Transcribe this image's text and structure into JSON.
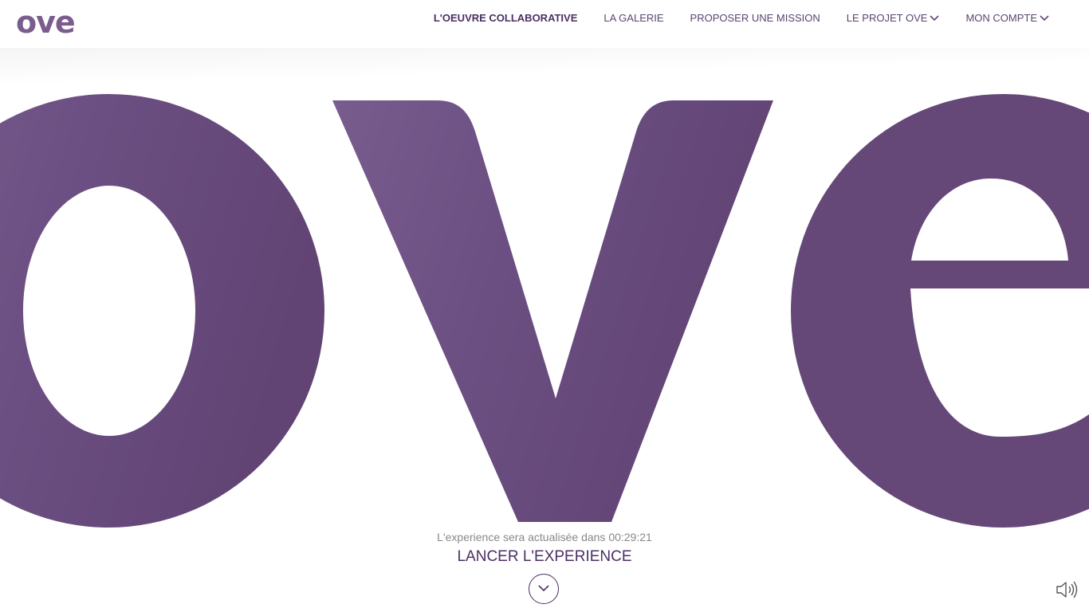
{
  "header": {
    "logo_text": "ove",
    "nav": [
      {
        "label": "L'OEUVRE COLLABORATIVE",
        "active": true
      },
      {
        "label": "LA GALERIE"
      },
      {
        "label": "PROPOSER UNE MISSION"
      },
      {
        "label": "LE PROJET OVE",
        "has_dropdown": true
      },
      {
        "label": "MON COMPTE",
        "has_dropdown": true
      }
    ]
  },
  "hero": {
    "text": "ove"
  },
  "footer": {
    "refresh_text": "L'experience sera actualisée dans 00:29:21",
    "launch_label": "LANCER L'EXPERIENCE",
    "scroll_icon": "chevron-down-icon",
    "sound_icon": "speaker-icon"
  },
  "colors": {
    "brand_purple": "#4b2f63",
    "hero_purple": "#654878",
    "logo_purple": "#7b5c8e"
  }
}
